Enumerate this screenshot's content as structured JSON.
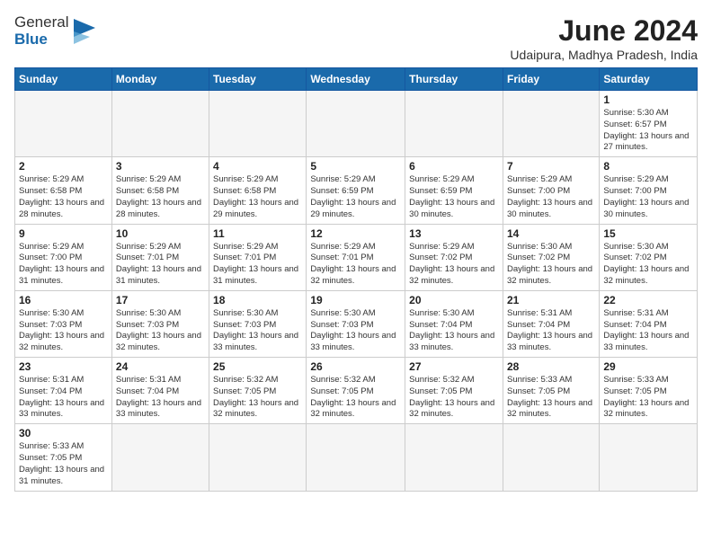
{
  "header": {
    "logo_text_regular": "General",
    "logo_text_blue": "Blue",
    "month_year": "June 2024",
    "subtitle": "Udaipura, Madhya Pradesh, India"
  },
  "weekdays": [
    "Sunday",
    "Monday",
    "Tuesday",
    "Wednesday",
    "Thursday",
    "Friday",
    "Saturday"
  ],
  "weeks": [
    [
      {
        "day": "",
        "info": ""
      },
      {
        "day": "",
        "info": ""
      },
      {
        "day": "",
        "info": ""
      },
      {
        "day": "",
        "info": ""
      },
      {
        "day": "",
        "info": ""
      },
      {
        "day": "",
        "info": ""
      },
      {
        "day": "1",
        "info": "Sunrise: 5:30 AM\nSunset: 6:57 PM\nDaylight: 13 hours and 27 minutes."
      }
    ],
    [
      {
        "day": "2",
        "info": "Sunrise: 5:29 AM\nSunset: 6:58 PM\nDaylight: 13 hours and 28 minutes."
      },
      {
        "day": "3",
        "info": "Sunrise: 5:29 AM\nSunset: 6:58 PM\nDaylight: 13 hours and 28 minutes."
      },
      {
        "day": "4",
        "info": "Sunrise: 5:29 AM\nSunset: 6:58 PM\nDaylight: 13 hours and 29 minutes."
      },
      {
        "day": "5",
        "info": "Sunrise: 5:29 AM\nSunset: 6:59 PM\nDaylight: 13 hours and 29 minutes."
      },
      {
        "day": "6",
        "info": "Sunrise: 5:29 AM\nSunset: 6:59 PM\nDaylight: 13 hours and 30 minutes."
      },
      {
        "day": "7",
        "info": "Sunrise: 5:29 AM\nSunset: 7:00 PM\nDaylight: 13 hours and 30 minutes."
      },
      {
        "day": "8",
        "info": "Sunrise: 5:29 AM\nSunset: 7:00 PM\nDaylight: 13 hours and 30 minutes."
      }
    ],
    [
      {
        "day": "9",
        "info": "Sunrise: 5:29 AM\nSunset: 7:00 PM\nDaylight: 13 hours and 31 minutes."
      },
      {
        "day": "10",
        "info": "Sunrise: 5:29 AM\nSunset: 7:01 PM\nDaylight: 13 hours and 31 minutes."
      },
      {
        "day": "11",
        "info": "Sunrise: 5:29 AM\nSunset: 7:01 PM\nDaylight: 13 hours and 31 minutes."
      },
      {
        "day": "12",
        "info": "Sunrise: 5:29 AM\nSunset: 7:01 PM\nDaylight: 13 hours and 32 minutes."
      },
      {
        "day": "13",
        "info": "Sunrise: 5:29 AM\nSunset: 7:02 PM\nDaylight: 13 hours and 32 minutes."
      },
      {
        "day": "14",
        "info": "Sunrise: 5:30 AM\nSunset: 7:02 PM\nDaylight: 13 hours and 32 minutes."
      },
      {
        "day": "15",
        "info": "Sunrise: 5:30 AM\nSunset: 7:02 PM\nDaylight: 13 hours and 32 minutes."
      }
    ],
    [
      {
        "day": "16",
        "info": "Sunrise: 5:30 AM\nSunset: 7:03 PM\nDaylight: 13 hours and 32 minutes."
      },
      {
        "day": "17",
        "info": "Sunrise: 5:30 AM\nSunset: 7:03 PM\nDaylight: 13 hours and 32 minutes."
      },
      {
        "day": "18",
        "info": "Sunrise: 5:30 AM\nSunset: 7:03 PM\nDaylight: 13 hours and 33 minutes."
      },
      {
        "day": "19",
        "info": "Sunrise: 5:30 AM\nSunset: 7:03 PM\nDaylight: 13 hours and 33 minutes."
      },
      {
        "day": "20",
        "info": "Sunrise: 5:30 AM\nSunset: 7:04 PM\nDaylight: 13 hours and 33 minutes."
      },
      {
        "day": "21",
        "info": "Sunrise: 5:31 AM\nSunset: 7:04 PM\nDaylight: 13 hours and 33 minutes."
      },
      {
        "day": "22",
        "info": "Sunrise: 5:31 AM\nSunset: 7:04 PM\nDaylight: 13 hours and 33 minutes."
      }
    ],
    [
      {
        "day": "23",
        "info": "Sunrise: 5:31 AM\nSunset: 7:04 PM\nDaylight: 13 hours and 33 minutes."
      },
      {
        "day": "24",
        "info": "Sunrise: 5:31 AM\nSunset: 7:04 PM\nDaylight: 13 hours and 33 minutes."
      },
      {
        "day": "25",
        "info": "Sunrise: 5:32 AM\nSunset: 7:05 PM\nDaylight: 13 hours and 32 minutes."
      },
      {
        "day": "26",
        "info": "Sunrise: 5:32 AM\nSunset: 7:05 PM\nDaylight: 13 hours and 32 minutes."
      },
      {
        "day": "27",
        "info": "Sunrise: 5:32 AM\nSunset: 7:05 PM\nDaylight: 13 hours and 32 minutes."
      },
      {
        "day": "28",
        "info": "Sunrise: 5:33 AM\nSunset: 7:05 PM\nDaylight: 13 hours and 32 minutes."
      },
      {
        "day": "29",
        "info": "Sunrise: 5:33 AM\nSunset: 7:05 PM\nDaylight: 13 hours and 32 minutes."
      }
    ],
    [
      {
        "day": "30",
        "info": "Sunrise: 5:33 AM\nSunset: 7:05 PM\nDaylight: 13 hours and 31 minutes."
      },
      {
        "day": "",
        "info": ""
      },
      {
        "day": "",
        "info": ""
      },
      {
        "day": "",
        "info": ""
      },
      {
        "day": "",
        "info": ""
      },
      {
        "day": "",
        "info": ""
      },
      {
        "day": "",
        "info": ""
      }
    ]
  ]
}
